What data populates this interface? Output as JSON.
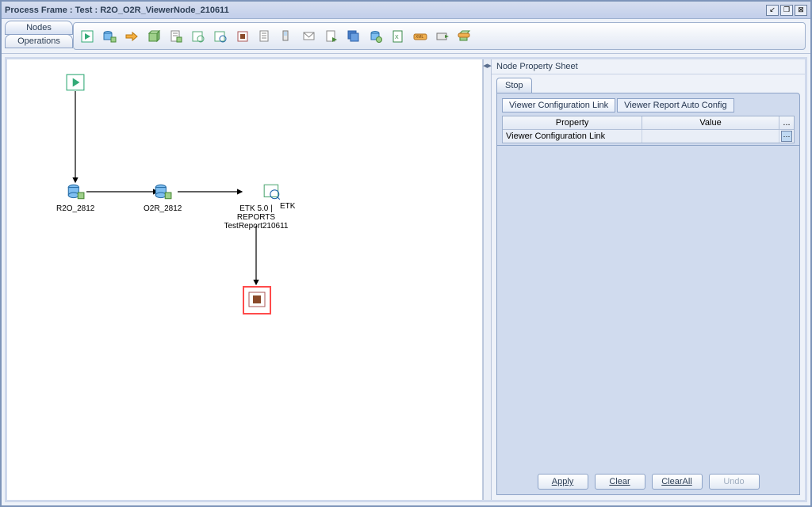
{
  "window": {
    "title": "Process Frame : Test : R2O_O2R_ViewerNode_210611"
  },
  "sidebar_tabs": {
    "nodes": "Nodes",
    "operations": "Operations"
  },
  "canvas_nodes": {
    "r2o": "R2O_2812",
    "o2r": "O2R_2812",
    "etk_viewer": "ETK 5.0 |\nREPORTS\nTestReport210611",
    "etk": "ETK"
  },
  "right_panel": {
    "title": "Node Property Sheet",
    "tab_stop": "Stop",
    "subtab_link": "Viewer Configuration Link",
    "subtab_auto": "Viewer Report Auto Config",
    "col_property": "Property",
    "col_value": "Value",
    "col_more": "...",
    "row_property": "Viewer Configuration Link",
    "row_value": ""
  },
  "buttons": {
    "apply": "Apply",
    "clear": "Clear",
    "clearall": "ClearAll",
    "undo": "Undo"
  },
  "toolbar_icons": [
    "start-icon",
    "db-add-icon",
    "arrow-icon",
    "cube-icon",
    "doc-icon",
    "sheet-icon",
    "chart-icon",
    "stop-icon",
    "page-icon",
    "device-icon",
    "mail-icon",
    "doc2-icon",
    "multi-icon",
    "db2-icon",
    "xls-icon",
    "xml-icon",
    "send-icon",
    "cube2-icon"
  ]
}
